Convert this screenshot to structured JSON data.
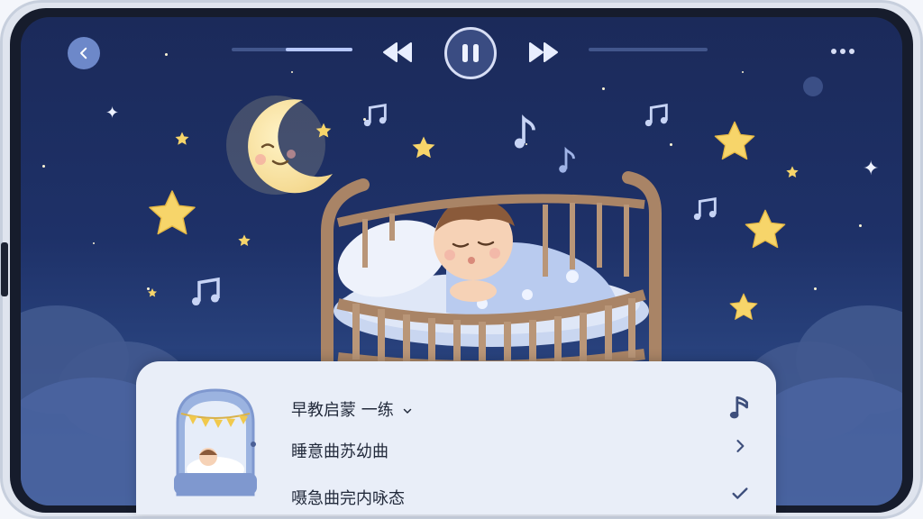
{
  "header": {
    "back_icon": "chevron-left-icon",
    "progress_left": 0.55,
    "progress_right": 0.0,
    "controls": [
      "rewind-icon",
      "pause-icon",
      "fast-forward-icon"
    ],
    "more_icon": "more-icon"
  },
  "scene": {
    "description_icons": [
      "moon-icon",
      "star-icon",
      "music-note-icon",
      "crib-icon",
      "baby-icon"
    ]
  },
  "sheet": {
    "category_label": "早教启蒙 一练",
    "category_dropdown_icon": "chevron-down-icon",
    "rows": [
      {
        "label": "睡意曲苏幼曲",
        "icon": "chevron-right-icon"
      },
      {
        "label": "嗫急曲完内咏态",
        "icon": "check-icon"
      }
    ],
    "music_icon": "music-note-icon"
  },
  "colors": {
    "sky_top": "#1b2a5a",
    "sky_bottom": "#3a5a96",
    "star": "#f7d56a",
    "sheet_bg": "#e9eef8",
    "accent": "#6d88c9"
  }
}
